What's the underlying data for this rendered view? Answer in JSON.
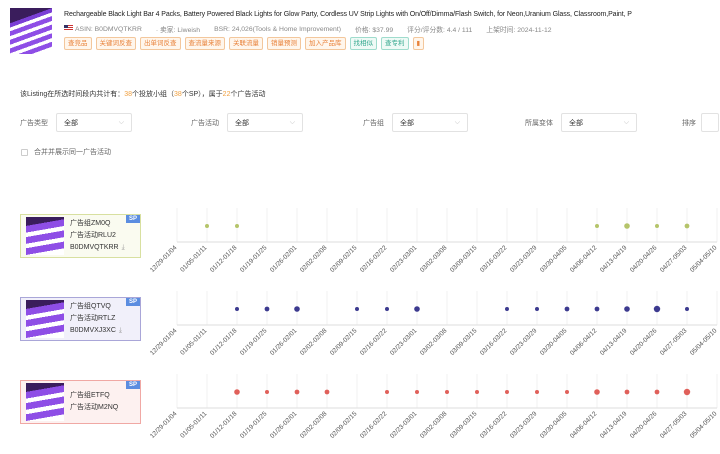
{
  "product": {
    "title": "Rechargeable Black Light Bar 4 Packs, Battery Powered Black Lights for Glow Party, Cordless UV Strip Lights with On/Off/Dimma/Flash Switch, for Neon,Uranium Glass, Classroom,Paint, P",
    "asin": "ASIN: B0DMVQTKRR",
    "seller": "· 卖家: Liweish",
    "bsr": "BSR: 24,026(Tools & Home Improvement)",
    "price": "价格: $37.99",
    "rating": "评分/评分数: 4.4 / 111",
    "launch": "上架时间: 2024-11-12",
    "tags": [
      {
        "label": "查竞品",
        "color": "orange"
      },
      {
        "label": "关键词反查",
        "color": "orange"
      },
      {
        "label": "出单词反查",
        "color": "orange"
      },
      {
        "label": "查流量来源",
        "color": "orange"
      },
      {
        "label": "关联流量",
        "color": "orange"
      },
      {
        "label": "销量预测",
        "color": "orange"
      },
      {
        "label": "加入产品库",
        "color": "orange"
      },
      {
        "label": "找相似",
        "color": "green"
      },
      {
        "label": "查专利",
        "color": "green"
      },
      {
        "label": "▮",
        "color": "orange"
      }
    ]
  },
  "summary": {
    "prefix": "该Listing在所选时间段内共计有：",
    "groups": "38",
    "mid1": "个投放小组（",
    "sp": "38",
    "mid2": "个SP），属于",
    "campaigns": "22",
    "suffix": "个广告活动"
  },
  "filters": [
    {
      "label": "广告类型",
      "value": "全部"
    },
    {
      "label": "广告活动",
      "value": "全部"
    },
    {
      "label": "广告组",
      "value": "全部"
    },
    {
      "label": "所属变体",
      "value": "全部"
    },
    {
      "label": "排序",
      "value": ""
    }
  ],
  "merge_checkbox": "合并并展示同一广告活动",
  "chart_data": {
    "type": "scatter",
    "categories": [
      "12/29-01/04",
      "01/05-01/11",
      "01/12-01/18",
      "01/19-01/25",
      "01/26-02/01",
      "02/02-02/08",
      "02/09-02/15",
      "02/16-02/22",
      "02/23-03/01",
      "03/02-03/08",
      "03/09-03/15",
      "03/16-03/22",
      "03/23-03/29",
      "03/30-04/05",
      "04/06-04/12",
      "04/13-04/19",
      "04/20-04/26",
      "04/27-05/03",
      "05/04-05/10"
    ],
    "series": [
      {
        "group": "广告组ZM0Q",
        "campaign": "广告活动RLU2",
        "asin": "B0DMVQTKRR",
        "badge": "SP",
        "color": "#b5c46a",
        "border": "#d8e0a0",
        "bg": "#fafbf0",
        "points": [
          [
            1,
            1
          ],
          [
            2,
            1
          ],
          [
            14,
            1
          ],
          [
            15,
            2
          ],
          [
            16,
            1
          ],
          [
            17,
            1.5
          ]
        ]
      },
      {
        "group": "广告组QTVQ",
        "campaign": "广告活动RTLZ",
        "asin": "B0DMVXJ3XC",
        "badge": "SP",
        "color": "#3c3a8f",
        "border": "#a9a6d8",
        "bg": "#f1f0fa",
        "points": [
          [
            2,
            1
          ],
          [
            3,
            1.5
          ],
          [
            4,
            2
          ],
          [
            6,
            1
          ],
          [
            7,
            1
          ],
          [
            8,
            2
          ],
          [
            11,
            1
          ],
          [
            12,
            1
          ],
          [
            13,
            1.5
          ],
          [
            14,
            1.5
          ],
          [
            15,
            2
          ],
          [
            16,
            2.5
          ],
          [
            17,
            1
          ]
        ]
      },
      {
        "group": "广告组ETFQ",
        "campaign": "广告活动M2NQ",
        "asin": "",
        "badge": "SP",
        "color": "#e0605a",
        "border": "#f0a8a4",
        "bg": "#fdf1f0",
        "points": [
          [
            2,
            2
          ],
          [
            3,
            1
          ],
          [
            4,
            1.5
          ],
          [
            5,
            1.5
          ],
          [
            7,
            1
          ],
          [
            8,
            1
          ],
          [
            9,
            1
          ],
          [
            10,
            1
          ],
          [
            11,
            1
          ],
          [
            12,
            1
          ],
          [
            13,
            1
          ],
          [
            14,
            2
          ],
          [
            15,
            1.5
          ],
          [
            16,
            1.5
          ],
          [
            17,
            2.5
          ]
        ]
      }
    ]
  }
}
